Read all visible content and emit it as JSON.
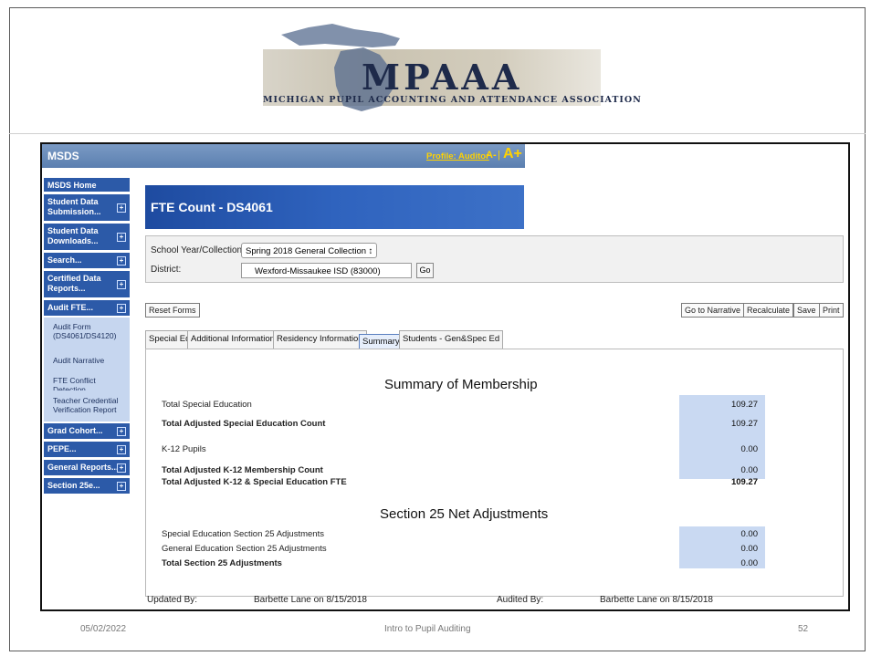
{
  "logo": {
    "name": "MPAAA",
    "tagline": "MICHIGAN PUPIL ACCOUNTING AND ATTENDANCE ASSOCIATION"
  },
  "app": {
    "title": "MSDS",
    "profile": "Profile: Auditor",
    "font_small": "A-",
    "font_sep": "|",
    "font_large": "A+"
  },
  "sidebar": {
    "items": [
      {
        "label": "MSDS Home"
      },
      {
        "label": "Student Data Submission...",
        "expand": "+"
      },
      {
        "label": "Student Data Downloads...",
        "expand": "+"
      },
      {
        "label": "Search...",
        "expand": "+"
      },
      {
        "label": "Certified Data Reports...",
        "expand": "+"
      },
      {
        "label": "Audit FTE...",
        "expand": "+"
      },
      {
        "label": "Grad Cohort...",
        "expand": "+"
      },
      {
        "label": "PEPE...",
        "expand": "+"
      },
      {
        "label": "General Reports...",
        "expand": "+"
      },
      {
        "label": "Section 25e...",
        "expand": "+"
      }
    ],
    "sub_items": [
      {
        "label": "Audit Form (DS4061/DS4120)"
      },
      {
        "label": "Audit Narrative"
      },
      {
        "label": "FTE Conflict Detection"
      },
      {
        "label": "Teacher Credential Verification Report"
      }
    ]
  },
  "page": {
    "title": "FTE Count - DS4061"
  },
  "filters": {
    "year_label": "School Year/Collection:",
    "year_value": "Spring 2018 General Collection ↕",
    "district_label": "District:",
    "district_value": "Wexford-Missaukee ISD (83000)",
    "go_label": "Go"
  },
  "buttons": {
    "reset": "Reset Forms",
    "narrative": "Go to Narrative",
    "recalculate": "Recalculate",
    "save": "Save",
    "print": "Print"
  },
  "tabs": [
    {
      "label": "Special Ed"
    },
    {
      "label": "Additional Information"
    },
    {
      "label": "Residency Information"
    },
    {
      "label": "Summary",
      "active": true
    },
    {
      "label": "Students - Gen&Spec Ed"
    }
  ],
  "summary": {
    "membership_title": "Summary of Membership",
    "rows": [
      {
        "label": "Total Special Education",
        "value": "109.27",
        "bold": false
      },
      {
        "label": "Total Adjusted Special Education Count",
        "value": "109.27",
        "bold": true
      },
      {
        "label": "K-12 Pupils",
        "value": "0.00",
        "bold": false
      },
      {
        "label": "Total Adjusted K-12 Membership Count",
        "value": "0.00",
        "bold": true
      },
      {
        "label": "Total Adjusted K-12 & Special Education FTE",
        "value": "109.27",
        "bold": true
      }
    ],
    "section25_title": "Section 25 Net Adjustments",
    "section25_rows": [
      {
        "label": "Special Education Section 25 Adjustments",
        "value": "0.00",
        "bold": false
      },
      {
        "label": "General Education Section 25 Adjustments",
        "value": "0.00",
        "bold": false
      },
      {
        "label": "Total Section 25 Adjustments",
        "value": "0.00",
        "bold": true
      }
    ]
  },
  "footer": {
    "updated_label": "Updated By:",
    "updated_value": "Barbette Lane on 8/15/2018",
    "audited_label": "Audited By:",
    "audited_value": "Barbette Lane on 8/15/2018"
  },
  "slide": {
    "date": "05/02/2022",
    "title": "Intro to Pupil Auditing",
    "page": "52"
  },
  "colors": {
    "nav_blue": "#2c5aa8",
    "banner_blue": "#1e4ba0",
    "value_highlight": "#c9d9f2",
    "accent_yellow": "#ffd200"
  }
}
